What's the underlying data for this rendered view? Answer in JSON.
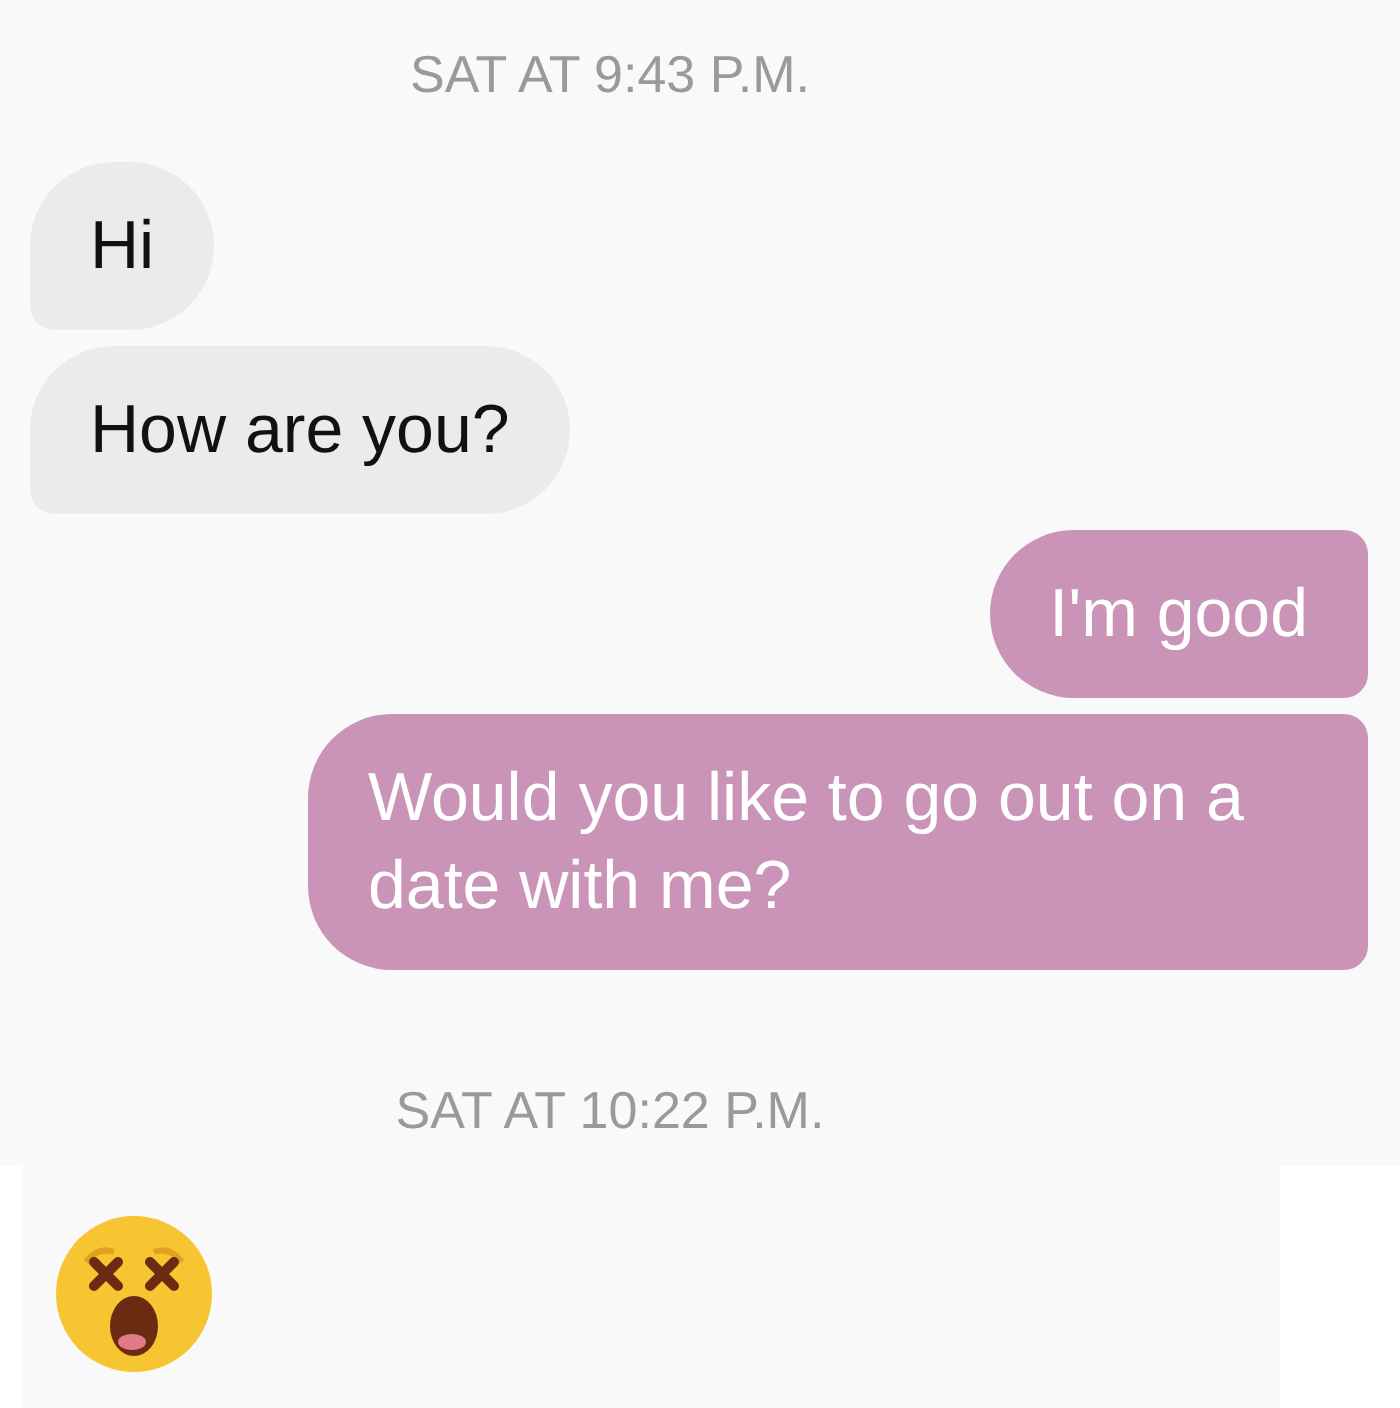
{
  "sections": [
    {
      "timestamp": "SAT AT 9:43 P.M.",
      "messages": [
        {
          "kind": "text",
          "outgoing": false,
          "text": "Hi"
        },
        {
          "kind": "text",
          "outgoing": false,
          "text": "How are you?"
        },
        {
          "kind": "text",
          "outgoing": true,
          "text": "I'm good"
        },
        {
          "kind": "text",
          "outgoing": true,
          "text": "Would you like to go out on a date with me?"
        }
      ]
    },
    {
      "timestamp": "SAT AT 10:22 P.M.",
      "messages": [
        {
          "kind": "emoji",
          "outgoing": false
        }
      ]
    }
  ]
}
